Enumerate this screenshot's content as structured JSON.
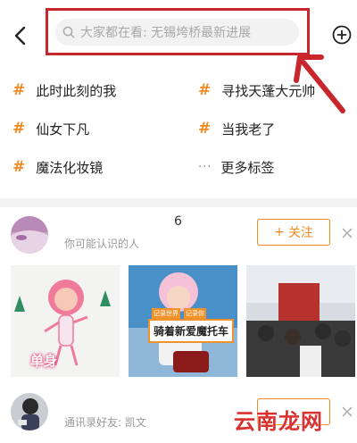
{
  "search": {
    "placeholder": "大家都在看: 无锡垮桥最新进展"
  },
  "tags": {
    "items": [
      {
        "label": "此时此刻的我",
        "icon": "hash-icon"
      },
      {
        "label": "寻找天蓬大元帅",
        "icon": "hash-icon"
      },
      {
        "label": "仙女下凡",
        "icon": "hash-icon"
      },
      {
        "label": "当我老了",
        "icon": "hash-icon"
      },
      {
        "label": "魔法化妆镜",
        "icon": "hash-icon"
      }
    ],
    "more": {
      "label": "更多标签",
      "icon": "more-dots-icon"
    }
  },
  "recommend": {
    "user1": {
      "name": "6",
      "subtitle": "你可能认识的人",
      "follow_label": "关注",
      "follow_plus": "+"
    },
    "thumbs": [
      {
        "caption": "单身"
      },
      {
        "sticker_top_a": "记录世界",
        "sticker_top_b": "记录你",
        "caption": "骑着新爱魔托车"
      },
      {}
    ],
    "user2": {
      "subtitle": "通讯录好友: 凯文"
    }
  },
  "watermark": "云南龙网",
  "colors": {
    "accent": "#f08a23",
    "highlight": "#c9262c"
  }
}
